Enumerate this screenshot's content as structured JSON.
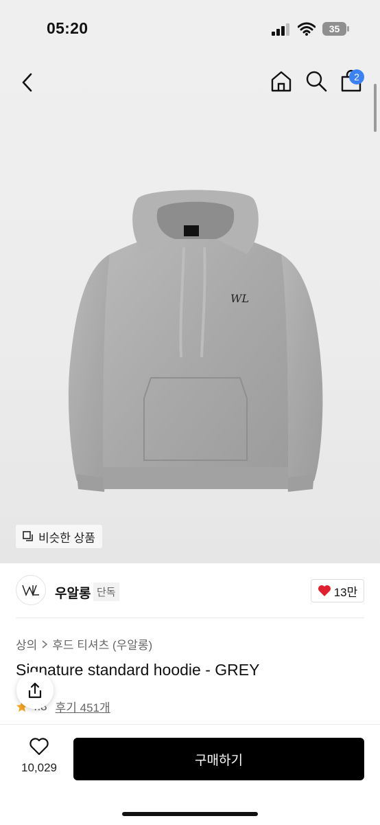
{
  "status_bar": {
    "time": "05:20",
    "battery": "35"
  },
  "header": {
    "cart_count": "2"
  },
  "hero": {
    "similar_label": "비슷한 상품"
  },
  "brand": {
    "name": "우알롱",
    "tag": "단독",
    "like_count": "13만"
  },
  "breadcrumb": {
    "items": [
      "상의",
      "후드 티셔츠 (우알롱)"
    ]
  },
  "product": {
    "title": "Signature standard hoodie - GREY",
    "rating": "4.8",
    "reviews_label": "후기 451개"
  },
  "bottom_bar": {
    "wish_count": "10,029",
    "buy_label": "구매하기"
  },
  "colors": {
    "accent_badge": "#3b82f6",
    "heart": "#e0202f",
    "star": "#f5a623",
    "buy_button": "#000000"
  }
}
